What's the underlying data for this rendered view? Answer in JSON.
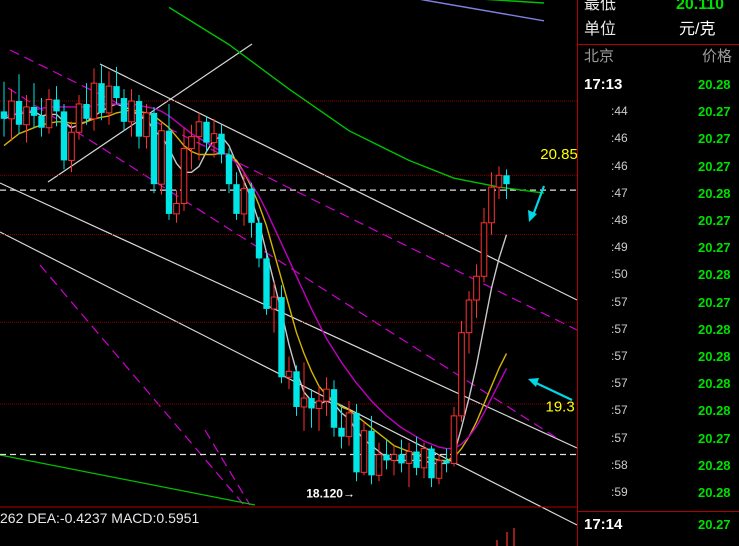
{
  "chart_data": {
    "type": "candlestick",
    "ylim": [
      17.9,
      21.3
    ],
    "candles": [
      {
        "o": 20.55,
        "h": 20.75,
        "l": 20.38,
        "c": 20.5
      },
      {
        "o": 20.5,
        "h": 20.7,
        "l": 20.35,
        "c": 20.62
      },
      {
        "o": 20.62,
        "h": 20.8,
        "l": 20.4,
        "c": 20.46
      },
      {
        "o": 20.46,
        "h": 20.66,
        "l": 20.34,
        "c": 20.58
      },
      {
        "o": 20.58,
        "h": 20.74,
        "l": 20.44,
        "c": 20.52
      },
      {
        "o": 20.52,
        "h": 20.64,
        "l": 20.38,
        "c": 20.44
      },
      {
        "o": 20.44,
        "h": 20.7,
        "l": 20.4,
        "c": 20.63
      },
      {
        "o": 20.63,
        "h": 20.72,
        "l": 20.45,
        "c": 20.55
      },
      {
        "o": 20.55,
        "h": 20.6,
        "l": 20.16,
        "c": 20.22
      },
      {
        "o": 20.22,
        "h": 20.48,
        "l": 20.14,
        "c": 20.41
      },
      {
        "o": 20.41,
        "h": 20.66,
        "l": 20.36,
        "c": 20.6
      },
      {
        "o": 20.6,
        "h": 20.74,
        "l": 20.46,
        "c": 20.5
      },
      {
        "o": 20.5,
        "h": 20.84,
        "l": 20.42,
        "c": 20.74
      },
      {
        "o": 20.74,
        "h": 20.86,
        "l": 20.49,
        "c": 20.54
      },
      {
        "o": 20.54,
        "h": 20.82,
        "l": 20.46,
        "c": 20.72
      },
      {
        "o": 20.72,
        "h": 20.85,
        "l": 20.6,
        "c": 20.64
      },
      {
        "o": 20.64,
        "h": 20.7,
        "l": 20.42,
        "c": 20.48
      },
      {
        "o": 20.48,
        "h": 20.7,
        "l": 20.38,
        "c": 20.62
      },
      {
        "o": 20.62,
        "h": 20.66,
        "l": 20.3,
        "c": 20.38
      },
      {
        "o": 20.38,
        "h": 20.6,
        "l": 20.3,
        "c": 20.54
      },
      {
        "o": 20.54,
        "h": 20.58,
        "l": 20.0,
        "c": 20.06
      },
      {
        "o": 20.06,
        "h": 20.48,
        "l": 19.99,
        "c": 20.42
      },
      {
        "o": 20.42,
        "h": 20.6,
        "l": 19.82,
        "c": 19.86
      },
      {
        "o": 19.86,
        "h": 20.02,
        "l": 19.8,
        "c": 19.93
      },
      {
        "o": 19.93,
        "h": 20.44,
        "l": 19.88,
        "c": 20.3
      },
      {
        "o": 20.3,
        "h": 20.46,
        "l": 20.16,
        "c": 20.38
      },
      {
        "o": 20.38,
        "h": 20.54,
        "l": 20.22,
        "c": 20.48
      },
      {
        "o": 20.48,
        "h": 20.52,
        "l": 20.28,
        "c": 20.34
      },
      {
        "o": 20.34,
        "h": 20.5,
        "l": 20.24,
        "c": 20.4
      },
      {
        "o": 20.4,
        "h": 20.46,
        "l": 20.2,
        "c": 20.26
      },
      {
        "o": 20.26,
        "h": 20.3,
        "l": 20.0,
        "c": 20.06
      },
      {
        "o": 20.06,
        "h": 20.14,
        "l": 19.82,
        "c": 19.86
      },
      {
        "o": 19.86,
        "h": 20.14,
        "l": 19.78,
        "c": 20.03
      },
      {
        "o": 20.03,
        "h": 20.07,
        "l": 19.7,
        "c": 19.8
      },
      {
        "o": 19.8,
        "h": 19.84,
        "l": 19.5,
        "c": 19.56
      },
      {
        "o": 19.56,
        "h": 19.6,
        "l": 19.18,
        "c": 19.22
      },
      {
        "o": 19.22,
        "h": 19.4,
        "l": 19.06,
        "c": 19.3
      },
      {
        "o": 19.3,
        "h": 19.38,
        "l": 18.72,
        "c": 18.76
      },
      {
        "o": 18.76,
        "h": 18.9,
        "l": 18.68,
        "c": 18.8
      },
      {
        "o": 18.8,
        "h": 18.84,
        "l": 18.5,
        "c": 18.56
      },
      {
        "o": 18.56,
        "h": 18.86,
        "l": 18.4,
        "c": 18.62
      },
      {
        "o": 18.62,
        "h": 18.68,
        "l": 18.42,
        "c": 18.55
      },
      {
        "o": 18.55,
        "h": 18.7,
        "l": 18.4,
        "c": 18.6
      },
      {
        "o": 18.6,
        "h": 18.76,
        "l": 18.5,
        "c": 18.68
      },
      {
        "o": 18.68,
        "h": 18.74,
        "l": 18.36,
        "c": 18.42
      },
      {
        "o": 18.42,
        "h": 18.56,
        "l": 18.28,
        "c": 18.36
      },
      {
        "o": 18.36,
        "h": 18.6,
        "l": 18.3,
        "c": 18.52
      },
      {
        "o": 18.52,
        "h": 18.58,
        "l": 18.06,
        "c": 18.12
      },
      {
        "o": 18.12,
        "h": 18.46,
        "l": 18.1,
        "c": 18.4
      },
      {
        "o": 18.4,
        "h": 18.5,
        "l": 18.04,
        "c": 18.1
      },
      {
        "o": 18.1,
        "h": 18.32,
        "l": 18.06,
        "c": 18.24
      },
      {
        "o": 18.24,
        "h": 18.34,
        "l": 18.14,
        "c": 18.2
      },
      {
        "o": 18.2,
        "h": 18.3,
        "l": 18.1,
        "c": 18.24
      },
      {
        "o": 18.24,
        "h": 18.34,
        "l": 18.12,
        "c": 18.18
      },
      {
        "o": 18.18,
        "h": 18.32,
        "l": 18.02,
        "c": 18.26
      },
      {
        "o": 18.26,
        "h": 18.36,
        "l": 18.1,
        "c": 18.15
      },
      {
        "o": 18.15,
        "h": 18.32,
        "l": 18.08,
        "c": 18.28
      },
      {
        "o": 18.28,
        "h": 18.3,
        "l": 18.02,
        "c": 18.08
      },
      {
        "o": 18.08,
        "h": 18.24,
        "l": 18.04,
        "c": 18.2
      },
      {
        "o": 18.2,
        "h": 18.28,
        "l": 18.12,
        "c": 18.18
      },
      {
        "o": 18.18,
        "h": 18.56,
        "l": 18.16,
        "c": 18.5
      },
      {
        "o": 18.5,
        "h": 19.14,
        "l": 18.46,
        "c": 19.06
      },
      {
        "o": 19.06,
        "h": 19.34,
        "l": 18.92,
        "c": 19.28
      },
      {
        "o": 19.28,
        "h": 19.52,
        "l": 19.16,
        "c": 19.44
      },
      {
        "o": 19.44,
        "h": 19.9,
        "l": 19.4,
        "c": 19.8
      },
      {
        "o": 19.8,
        "h": 20.14,
        "l": 19.72,
        "c": 20.04
      },
      {
        "o": 20.04,
        "h": 20.18,
        "l": 19.96,
        "c": 20.12
      },
      {
        "o": 20.12,
        "h": 20.16,
        "l": 19.96,
        "c": 20.06
      }
    ],
    "moving_averages": [
      {
        "color": "#c8c8c8",
        "values": [
          20.5,
          20.52,
          20.54,
          20.54,
          20.55,
          20.52,
          20.53,
          20.53,
          20.48,
          20.44,
          20.46,
          20.48,
          20.52,
          20.55,
          20.58,
          20.6,
          20.58,
          20.56,
          20.52,
          20.5,
          20.42,
          20.38,
          20.3,
          20.2,
          20.14,
          20.14,
          20.18,
          20.28,
          20.36,
          20.38,
          20.32,
          20.2,
          20.08,
          19.96,
          19.8,
          19.6,
          19.4,
          19.2,
          18.98,
          18.8,
          18.66,
          18.6,
          18.58,
          18.6,
          18.58,
          18.52,
          18.48,
          18.4,
          18.34,
          18.3,
          18.26,
          18.22,
          18.2,
          18.2,
          18.2,
          18.2,
          18.2,
          18.18,
          18.18,
          18.18,
          18.24,
          18.42,
          18.62,
          18.84,
          19.1,
          19.36,
          19.56,
          19.72
        ]
      },
      {
        "color": "#d4b400",
        "values": [
          20.32,
          20.36,
          20.4,
          20.42,
          20.44,
          20.46,
          20.47,
          20.48,
          20.48,
          20.47,
          20.47,
          20.48,
          20.5,
          20.51,
          20.52,
          20.54,
          20.55,
          20.56,
          20.55,
          20.54,
          20.52,
          20.48,
          20.44,
          20.38,
          20.32,
          20.28,
          20.26,
          20.26,
          20.26,
          20.27,
          20.26,
          20.22,
          20.14,
          20.04,
          19.92,
          19.78,
          19.6,
          19.42,
          19.24,
          19.06,
          18.92,
          18.8,
          18.7,
          18.64,
          18.6,
          18.56,
          18.54,
          18.5,
          18.46,
          18.42,
          18.38,
          18.34,
          18.3,
          18.28,
          18.26,
          18.24,
          18.22,
          18.22,
          18.2,
          18.2,
          18.22,
          18.28,
          18.36,
          18.46,
          18.58,
          18.7,
          18.82,
          18.92
        ]
      },
      {
        "color": "#c000c0",
        "values": [
          20.52,
          20.53,
          20.54,
          20.55,
          20.56,
          20.57,
          20.58,
          20.58,
          20.58,
          20.58,
          20.58,
          20.58,
          20.59,
          20.6,
          20.6,
          20.6,
          20.6,
          20.6,
          20.59,
          20.58,
          20.57,
          20.55,
          20.52,
          20.48,
          20.44,
          20.4,
          20.37,
          20.34,
          20.31,
          20.28,
          20.25,
          20.2,
          20.14,
          20.06,
          19.98,
          19.88,
          19.77,
          19.66,
          19.55,
          19.44,
          19.33,
          19.22,
          19.12,
          19.02,
          18.94,
          18.86,
          18.79,
          18.72,
          18.66,
          18.6,
          18.55,
          18.5,
          18.46,
          18.42,
          18.39,
          18.36,
          18.33,
          18.31,
          18.29,
          18.28,
          18.28,
          18.31,
          18.36,
          18.43,
          18.52,
          18.62,
          18.72,
          18.82
        ]
      }
    ],
    "long_mas": [
      {
        "color": "#00c000",
        "points": [
          [
            22,
            21.25
          ],
          [
            30,
            21.0
          ],
          [
            38,
            20.7
          ],
          [
            46,
            20.42
          ],
          [
            54,
            20.22
          ],
          [
            60,
            20.1
          ],
          [
            66,
            20.04
          ],
          [
            72,
            20.0
          ]
        ]
      },
      {
        "color": "#00c000",
        "points": [
          [
            22,
            21.6
          ],
          [
            40,
            21.45
          ],
          [
            56,
            21.33
          ],
          [
            72,
            21.28
          ]
        ]
      },
      {
        "color": "#e08020",
        "points": [
          [
            40,
            21.55
          ],
          [
            56,
            21.42
          ],
          [
            72,
            21.38
          ]
        ]
      },
      {
        "color": "#8080e0",
        "points": [
          [
            40,
            21.45
          ],
          [
            56,
            21.3
          ],
          [
            72,
            21.16
          ]
        ]
      }
    ],
    "hlines": [
      {
        "y": 20.02,
        "style": "dashed-white"
      },
      {
        "y": 18.24,
        "style": "dashed-white"
      },
      {
        "y": 20.62,
        "style": "red"
      },
      {
        "y": 20.12,
        "style": "red"
      },
      {
        "y": 19.72,
        "style": "red"
      },
      {
        "y": 19.13,
        "style": "red"
      },
      {
        "y": 18.58,
        "style": "red"
      }
    ],
    "annotations": [
      {
        "text": "20.85",
        "x": 71.5,
        "y": 20.23,
        "color": "#ffff00"
      },
      {
        "text": "19.3",
        "x": 72.2,
        "y": 18.53,
        "color": "#ffff00"
      },
      {
        "text": "18.120→",
        "x": 40.3,
        "y": 17.95,
        "color": "#ffffff"
      }
    ]
  },
  "side": {
    "low_label": "最低",
    "low_value": "20.110",
    "unit_label": "单位",
    "unit_value": "元/克",
    "city": "北京",
    "price_header": "价格",
    "ticks": [
      {
        "t": "17:13",
        "p": "20.28",
        "big": true
      },
      {
        "t": ":44",
        "p": "20.27"
      },
      {
        "t": ":46",
        "p": "20.27"
      },
      {
        "t": ":46",
        "p": "20.27"
      },
      {
        "t": ":47",
        "p": "20.28"
      },
      {
        "t": ":48",
        "p": "20.27"
      },
      {
        "t": ":49",
        "p": "20.27"
      },
      {
        "t": ":50",
        "p": "20.28"
      },
      {
        "t": ":57",
        "p": "20.27"
      },
      {
        "t": ":57",
        "p": "20.28"
      },
      {
        "t": ":57",
        "p": "20.28"
      },
      {
        "t": ":57",
        "p": "20.28"
      },
      {
        "t": ":57",
        "p": "20.28"
      },
      {
        "t": ":57",
        "p": "20.27"
      },
      {
        "t": ":58",
        "p": "20.28"
      },
      {
        "t": ":59",
        "p": "20.28"
      },
      {
        "t": "17:14",
        "p": "20.27",
        "big": true
      }
    ]
  },
  "macd_text": "262  DEA:-0.4237  MACD:0.5951"
}
